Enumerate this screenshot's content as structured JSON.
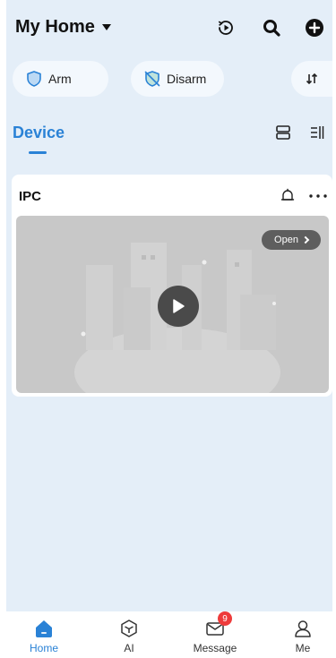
{
  "header": {
    "home_title": "My Home"
  },
  "modes": {
    "arm_label": "Arm",
    "disarm_label": "Disarm"
  },
  "tabs": {
    "device_label": "Device"
  },
  "device_card": {
    "name": "IPC",
    "open_label": "Open"
  },
  "tabbar": {
    "items": [
      {
        "label": "Home"
      },
      {
        "label": "AI"
      },
      {
        "label": "Message",
        "badge": "9"
      },
      {
        "label": "Me"
      }
    ]
  },
  "colors": {
    "accent": "#2a82d6",
    "background": "#e4eef8",
    "badge": "#ee3b3b"
  }
}
